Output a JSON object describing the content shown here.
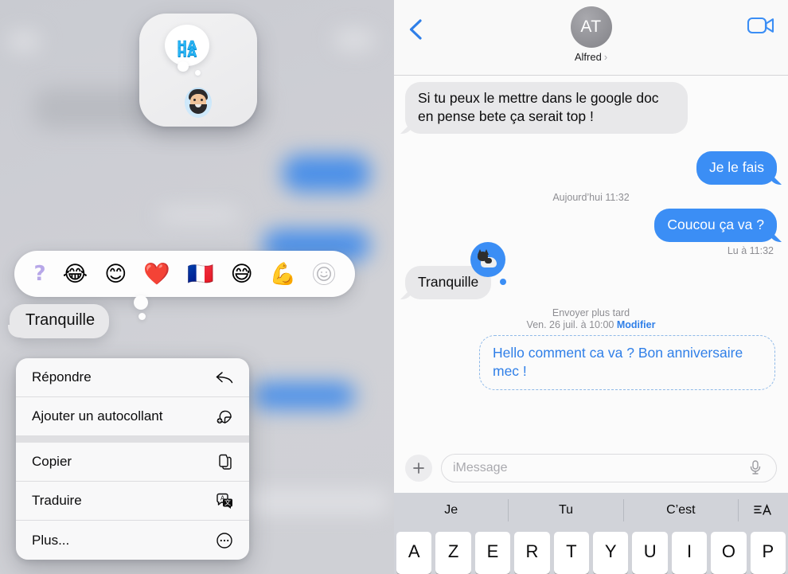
{
  "left_panel": {
    "sticker_preview": {
      "name": "sticker-preview-card",
      "thought_text_line1": "HA",
      "thought_text_line2": "HA",
      "avatar_name": "memoji-avatar"
    },
    "reaction_bar": {
      "emojis": [
        {
          "name": "question-mark-emoji",
          "glyph": "?"
        },
        {
          "name": "face-with-tears-of-joy-emoji",
          "glyph": "😂"
        },
        {
          "name": "smiling-face-smiling-eyes-emoji",
          "glyph": "😊"
        },
        {
          "name": "red-heart-emoji",
          "glyph": "❤️"
        },
        {
          "name": "flag-france-emoji",
          "glyph": "🇫🇷"
        },
        {
          "name": "grinning-face-sweat-emoji",
          "glyph": "😅"
        },
        {
          "name": "flexed-biceps-emoji",
          "glyph": "💪"
        }
      ],
      "more_label": "more-emoji-button"
    },
    "focused_message": "Tranquille",
    "context_menu": [
      {
        "label": "Répondre",
        "icon": "reply-icon",
        "name": "context-menu-item-reply"
      },
      {
        "label": "Ajouter un autocollant",
        "icon": "add-sticker-icon",
        "name": "context-menu-item-add-sticker"
      },
      {
        "label": "Copier",
        "icon": "copy-icon",
        "name": "context-menu-item-copy"
      },
      {
        "label": "Traduire",
        "icon": "translate-icon",
        "name": "context-menu-item-translate"
      },
      {
        "label": "Plus...",
        "icon": "ellipsis-circle-icon",
        "name": "context-menu-item-more"
      }
    ]
  },
  "right_panel": {
    "header": {
      "back_label": "back-chevron",
      "avatar_initials": "AT",
      "contact_name": "Alfred",
      "contact_chevron": "›",
      "video_call_label": "video-call-button"
    },
    "messages": [
      {
        "id": "msg-incoming-1",
        "direction": "in",
        "text": "Si tu peux le mettre dans le google doc en pense bete ça serait top !"
      },
      {
        "id": "msg-outgoing-1",
        "direction": "out",
        "text": "Je le fais"
      },
      {
        "id": "timestamp-1",
        "direction": "timestamp",
        "text": "Aujourd’hui 11:32"
      },
      {
        "id": "msg-outgoing-2",
        "direction": "out",
        "text": "Coucou ça va ?"
      },
      {
        "id": "read-receipt-1",
        "direction": "receipt",
        "text": "Lu à 11:32"
      },
      {
        "id": "msg-incoming-2",
        "direction": "in-sticker",
        "text": "Tranquille",
        "sticker": "cat-thought-bubble-sticker"
      }
    ],
    "scheduled": {
      "label": "Envoyer plus tard",
      "datetime": "Ven. 26 juil. à 10:00",
      "edit_label": "Modifier",
      "text": "Hello comment ca va ? Bon anniversaire mec !"
    },
    "input_bar": {
      "plus_label": "attachments-button",
      "placeholder": "iMessage",
      "value": "",
      "mic_label": "dictation-button"
    },
    "keyboard": {
      "predictions": [
        "Je",
        "Tu",
        "C’est"
      ],
      "format_icon": "text-format-icon",
      "keys": [
        "A",
        "Z",
        "E",
        "R",
        "T",
        "Y",
        "U",
        "I",
        "O",
        "P"
      ]
    }
  },
  "colors": {
    "accent_blue": "#3b8ef5",
    "link_blue": "#2f7fe8",
    "incoming_bubble": "#e8e8ea",
    "secondary_text": "#8e8e93",
    "keyboard_bg": "#d1d3d9"
  }
}
